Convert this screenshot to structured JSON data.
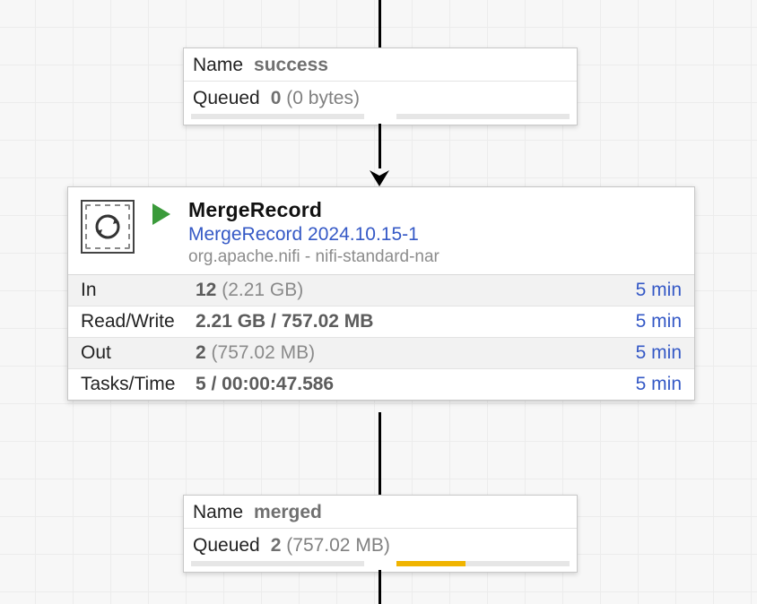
{
  "connection1": {
    "name_label": "Name",
    "name_value": "success",
    "queued_label": "Queued",
    "queued_count": "0",
    "queued_size": "(0 bytes)",
    "bar1_percent": 0,
    "bar2_percent": 0
  },
  "processor": {
    "name": "MergeRecord",
    "type": "MergeRecord 2024.10.15-1",
    "bundle": "org.apache.nifi - nifi-standard-nar",
    "run_state": "running",
    "stats": {
      "in": {
        "label": "In",
        "count": "12",
        "size": "(2.21 GB)",
        "window": "5 min"
      },
      "readwrite": {
        "label": "Read/Write",
        "value": "2.21 GB / 757.02 MB",
        "window": "5 min"
      },
      "out": {
        "label": "Out",
        "count": "2",
        "size": "(757.02 MB)",
        "window": "5 min"
      },
      "tasks": {
        "label": "Tasks/Time",
        "value": "5 / 00:00:47.586",
        "window": "5 min"
      }
    }
  },
  "connection2": {
    "name_label": "Name",
    "name_value": "merged",
    "queued_label": "Queued",
    "queued_count": "2",
    "queued_size": "(757.02 MB)",
    "bar1_percent": 0,
    "bar2_percent": 40
  },
  "colors": {
    "link": "#3559c6",
    "accent": "#f0b400"
  }
}
